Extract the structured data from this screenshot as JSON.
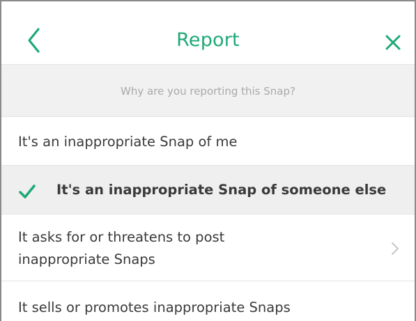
{
  "header": {
    "title": "Report"
  },
  "prompt": "Why are you reporting this Snap?",
  "options": [
    {
      "label": "It's an inappropriate Snap of me",
      "selected": false
    },
    {
      "label": "It's an inappropriate Snap of someone else",
      "selected": true
    },
    {
      "label_line1": "It asks for or threatens to post",
      "label_line2": "inappropriate Snaps",
      "selected": false
    },
    {
      "label": "It sells or promotes inappropriate Snaps",
      "selected": false
    }
  ],
  "icons": {
    "back": "chevron-left-icon",
    "close": "close-icon",
    "check": "checkmark-icon",
    "more": "chevron-right-icon"
  },
  "colors": {
    "accent": "#1ea977",
    "prompt_text": "#a9a9a9",
    "prompt_bg": "#f1f1f1",
    "selected_bg": "#efefef",
    "chevron": "#c7c7c7"
  }
}
